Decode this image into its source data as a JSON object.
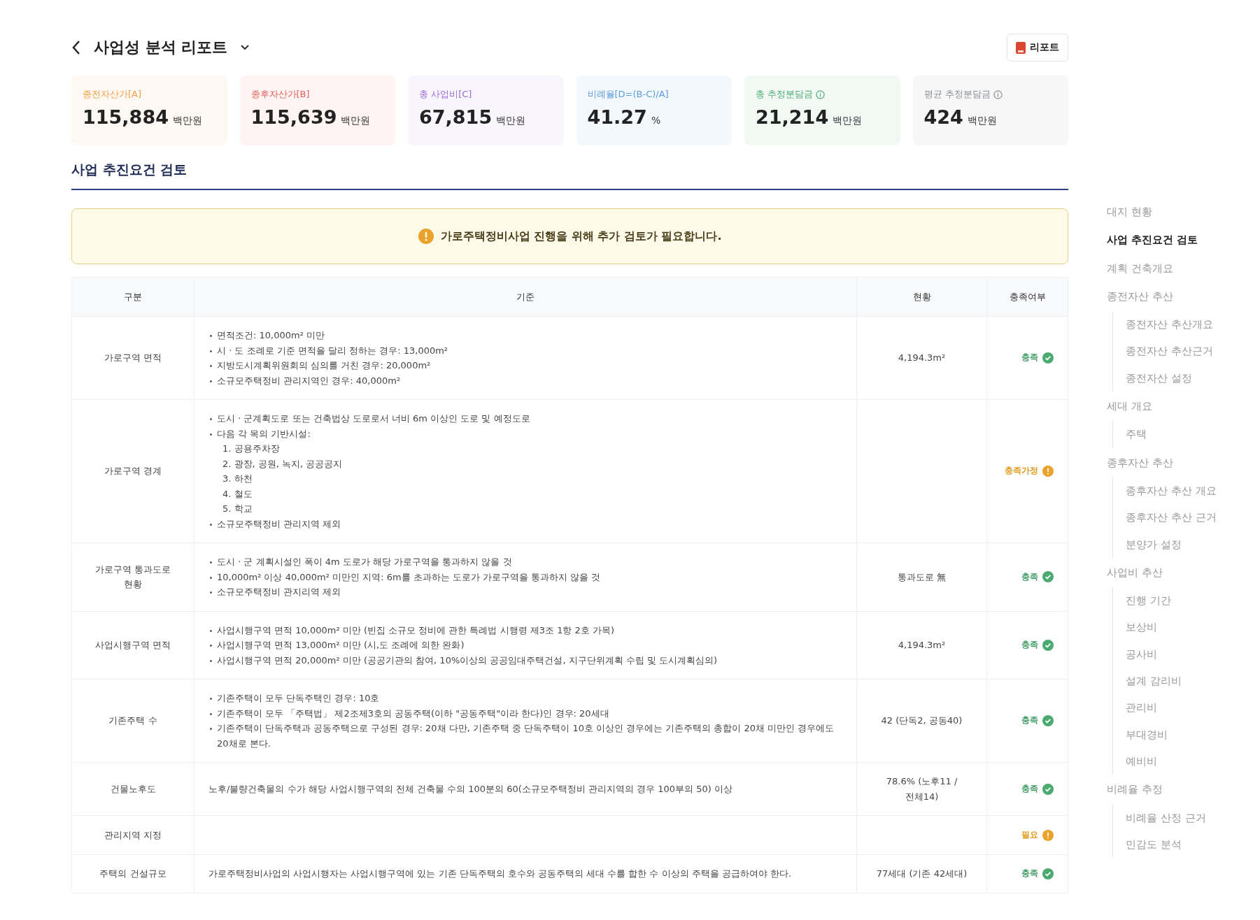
{
  "header": {
    "title": "사업성 분석 리포트",
    "report_button": "리포트"
  },
  "summary_cards": [
    {
      "label": "종전자산가[A]",
      "value": "115,884",
      "unit": "백만원",
      "color": "#f0a04b",
      "info": false
    },
    {
      "label": "종후자산가[B]",
      "value": "115,639",
      "unit": "백만원",
      "color": "#e0605a",
      "info": false
    },
    {
      "label": "총 사업비[C]",
      "value": "67,815",
      "unit": "백만원",
      "color": "#9b6bd8",
      "info": false
    },
    {
      "label": "비례율[D=(B-C)/A]",
      "value": "41.27",
      "unit": "%",
      "color": "#5b9be0",
      "info": false
    },
    {
      "label": "총 추정분담금",
      "value": "21,214",
      "unit": "백만원",
      "color": "#4cae74",
      "info": true
    },
    {
      "label": "평균 추정분담금",
      "value": "424",
      "unit": "백만원",
      "color": "#8a8f96",
      "info": true
    }
  ],
  "section_title": "사업 추진요건 검토",
  "alert": "가로주택정비사업 진행을 위해 추가 검토가 필요합니다.",
  "table": {
    "columns": [
      "구분",
      "기준",
      "현황",
      "충족여부"
    ],
    "rows": [
      {
        "category": "가로구역 면적",
        "criteria": [
          {
            "text": "면적조건: 10,000m² 미만"
          },
          {
            "text": "시 · 도 조례로 기준 면적을 달리 정하는 경우: 13,000m²"
          },
          {
            "text": "지방도시계획위원회의 심의를 거친 경우: 20,000m²"
          },
          {
            "text": "소규모주택정비 관리지역인 경우: 40,000m²"
          }
        ],
        "status": "4,194.3m²",
        "result": "충족",
        "kind": "ok"
      },
      {
        "category": "가로구역 경계",
        "criteria": [
          {
            "text": "도시 · 군계획도로 또는 건축법상 도로로서 너비 6m 이상인 도로 및 예정도로"
          },
          {
            "text": "다음 각 목의 기반시설:",
            "sub": [
              "1. 공용주차장",
              "2. 광장, 공원, 녹지, 공공공지",
              "3. 하천",
              "4. 철도",
              "5. 학교"
            ]
          },
          {
            "text": "소규모주택정비 관리지역 제외"
          }
        ],
        "result": "충족가정",
        "kind": "warn"
      },
      {
        "category": "가로구역 통과도로 현황",
        "criteria": [
          {
            "text": "도시 · 군 계획시설인 폭이 4m 도로가 해당 가로구역을 통과하지 않을 것"
          },
          {
            "text": "10,000m² 이상 40,000m² 미만인 지역: 6m를 초과하는 도로가 가로구역을 통과하지 않을 것"
          },
          {
            "text": "소규모주택정비 관지리역 제외"
          }
        ],
        "status": "통과도로 無",
        "result": "충족",
        "kind": "ok"
      },
      {
        "category": "사업시행구역 면적",
        "criteria": [
          {
            "text": "사업시행구역 면적 10,000m² 미만 (빈집 소규모 정비에 관한 특례법 시행령 제3조 1항 2호 가목)"
          },
          {
            "text": "사업시행구역 면적 13,000m² 미만 (시,도 조례에 의한 완화)"
          },
          {
            "text": "사업시행구역 면적 20,000m² 미만 (공공기관의 참여, 10%이상의 공공임대주택건설, 지구단위계획 수립 및 도시계획심의)"
          }
        ],
        "status": "4,194.3m²",
        "result": "충족",
        "kind": "ok"
      },
      {
        "category": "기존주택 수",
        "criteria": [
          {
            "text": "기존주택이 모두 단독주택인 경우: 10호"
          },
          {
            "text": "기존주택이 모두 「주택법」 제2조제3호의 공동주택(이하 \"공동주택\"이라 한다)인 경우: 20세대"
          },
          {
            "text": "기존주택이 단독주택과 공동주택으로 구성된 경우: 20채 다만, 기존주택 중 단독주택이 10호 이상인 경우에는 기존주택의 총합이 20채 미만인 경우에도 20채로 본다."
          }
        ],
        "status": "42 (단독2, 공동40)",
        "result": "충족",
        "kind": "ok"
      },
      {
        "category": "건물노후도",
        "note": "노후/불량건축물의 수가 해당 사업시행구역의 전체 건축물 수의 100분의 60(소규모주택정비 관리지역의 경우 100부의 50) 이상",
        "status": "78.6% (노후11 / 전체14)",
        "result": "충족",
        "kind": "ok"
      },
      {
        "category": "관리지역 지정",
        "result": "필요",
        "kind": "warn"
      },
      {
        "category": "주택의 건설규모",
        "note": "가로주택정비사업의 사업시행자는 사업시행구역에 있는 기존 단독주택의 호수와 공동주택의 세대 수를 합한 수 이상의 주택을 공급하여야 한다.",
        "status": "77세대 (기존 42세대)",
        "result": "충족",
        "kind": "ok"
      }
    ]
  },
  "nav": [
    {
      "label": "대지 현황",
      "selected": false
    },
    {
      "label": "사업 추진요건 검토",
      "selected": true
    },
    {
      "label": "계획 건축개요",
      "selected": false
    },
    {
      "label": "종전자산 추산",
      "selected": false,
      "children": [
        {
          "label": "종전자산 추산개요",
          "selected": false
        },
        {
          "label": "종전자산 추산근거",
          "selected": false
        },
        {
          "label": "종전자산 설정",
          "selected": false
        }
      ]
    },
    {
      "label": "세대 개요",
      "selected": false,
      "children": [
        {
          "label": "주택",
          "selected": false
        }
      ]
    },
    {
      "label": "종후자산 추산",
      "selected": false,
      "children": [
        {
          "label": "종후자산 추산 개요",
          "selected": false
        },
        {
          "label": "종후자산 추산 근거",
          "selected": false
        },
        {
          "label": "분양가 설정",
          "selected": false
        }
      ]
    },
    {
      "label": "사업비 추산",
      "selected": false,
      "children": [
        {
          "label": "진행 기간",
          "selected": false
        },
        {
          "label": "보상비",
          "selected": false
        },
        {
          "label": "공사비",
          "selected": false
        },
        {
          "label": "설계 감리비",
          "selected": false
        },
        {
          "label": "관리비",
          "selected": false
        },
        {
          "label": "부대경비",
          "selected": false
        },
        {
          "label": "예비비",
          "selected": false
        }
      ]
    },
    {
      "label": "비례율 추정",
      "selected": false,
      "children": [
        {
          "label": "비례율 산정 근거",
          "selected": false
        },
        {
          "label": "민감도 분석",
          "selected": false
        }
      ]
    }
  ]
}
